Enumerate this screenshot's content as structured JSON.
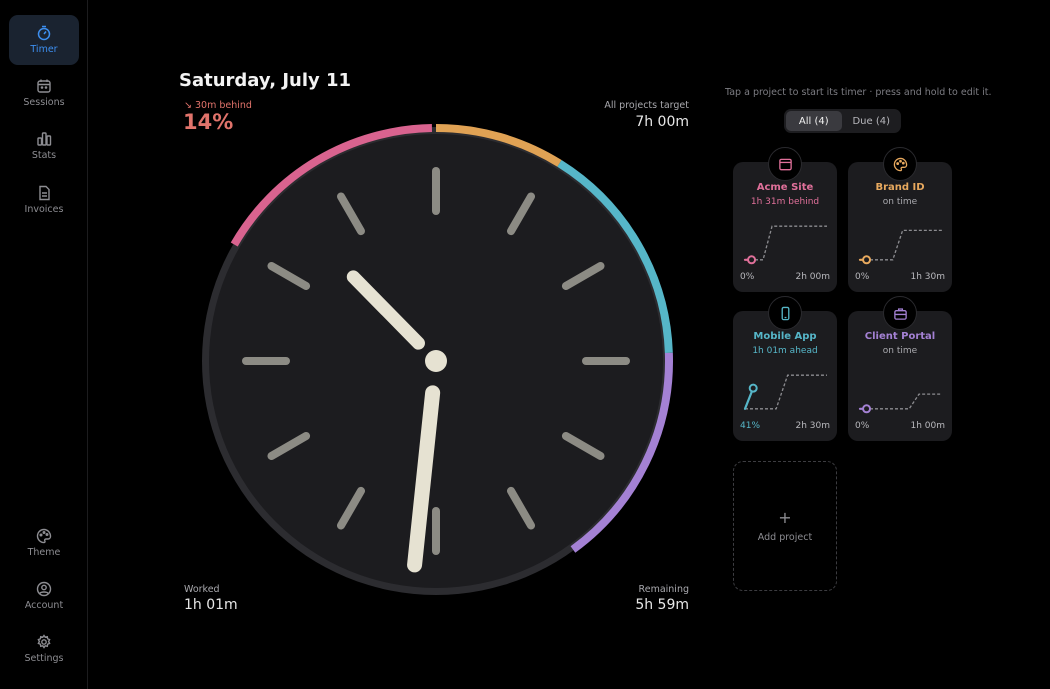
{
  "sidebar": {
    "items": [
      {
        "label": "Timer",
        "icon": "stopwatch-icon",
        "active": true
      },
      {
        "label": "Sessions",
        "icon": "calendar-icon"
      },
      {
        "label": "Stats",
        "icon": "bar-chart-icon"
      },
      {
        "label": "Invoices",
        "icon": "document-icon"
      }
    ],
    "bottom": [
      {
        "label": "Theme",
        "icon": "palette-icon"
      },
      {
        "label": "Account",
        "icon": "user-icon"
      },
      {
        "label": "Settings",
        "icon": "gear-icon"
      }
    ],
    "active_color": "#3d8ff0"
  },
  "main": {
    "date": "Saturday, July 11",
    "behind": "↘ 30m behind",
    "percent": "14%",
    "target_label": "All projects target",
    "target_value": "7h 00m",
    "worked_label": "Worked",
    "worked_value": "1h 01m",
    "remaining_label": "Remaining",
    "remaining_value": "5h 59m",
    "status_color": "#e0736b"
  },
  "clock": {
    "hour": 10,
    "minute": 31,
    "ring_colors": [
      "#d9638f",
      "#e0a254",
      "#56b6c8",
      "#a481d4"
    ]
  },
  "panel": {
    "hint": "Tap a project to start its timer · press and hold to edit it.",
    "filters": [
      "All (4)",
      "Due (4)"
    ],
    "active_filter": 0,
    "add_label": "Add project"
  },
  "projects": [
    {
      "name": "Acme Site",
      "status": "1h 31m behind",
      "percent": "0%",
      "total": "2h 00m",
      "color": "#e0709a",
      "icon": "browser-window-icon",
      "status_color": "#e0709a",
      "progress": 0.0,
      "steps": [
        [
          0.22,
          0.9
        ],
        [
          0.33,
          0.1
        ],
        [
          1.0,
          0.1
        ]
      ]
    },
    {
      "name": "Brand ID",
      "status": "on time",
      "percent": "0%",
      "total": "1h 30m",
      "color": "#e8a95e",
      "icon": "palette-icon",
      "status_color": "#a9a9ae",
      "progress": 0.0,
      "steps": [
        [
          0.4,
          0.9
        ],
        [
          0.52,
          0.2
        ],
        [
          1.0,
          0.2
        ]
      ]
    },
    {
      "name": "Mobile App",
      "status": "1h 01m ahead",
      "percent": "41%",
      "total": "2h 30m",
      "color": "#56b6c8",
      "icon": "phone-icon",
      "status_color": "#56b6c8",
      "progress": 0.41,
      "steps": [
        [
          0.38,
          0.9
        ],
        [
          0.52,
          0.1
        ],
        [
          1.0,
          0.1
        ]
      ]
    },
    {
      "name": "Client Portal",
      "status": "on time",
      "percent": "0%",
      "total": "1h 00m",
      "color": "#a481d4",
      "icon": "briefcase-icon",
      "status_color": "#a9a9ae",
      "progress": 0.0,
      "steps": [
        [
          0.6,
          0.9
        ],
        [
          0.72,
          0.55
        ],
        [
          1.0,
          0.55
        ]
      ]
    }
  ]
}
